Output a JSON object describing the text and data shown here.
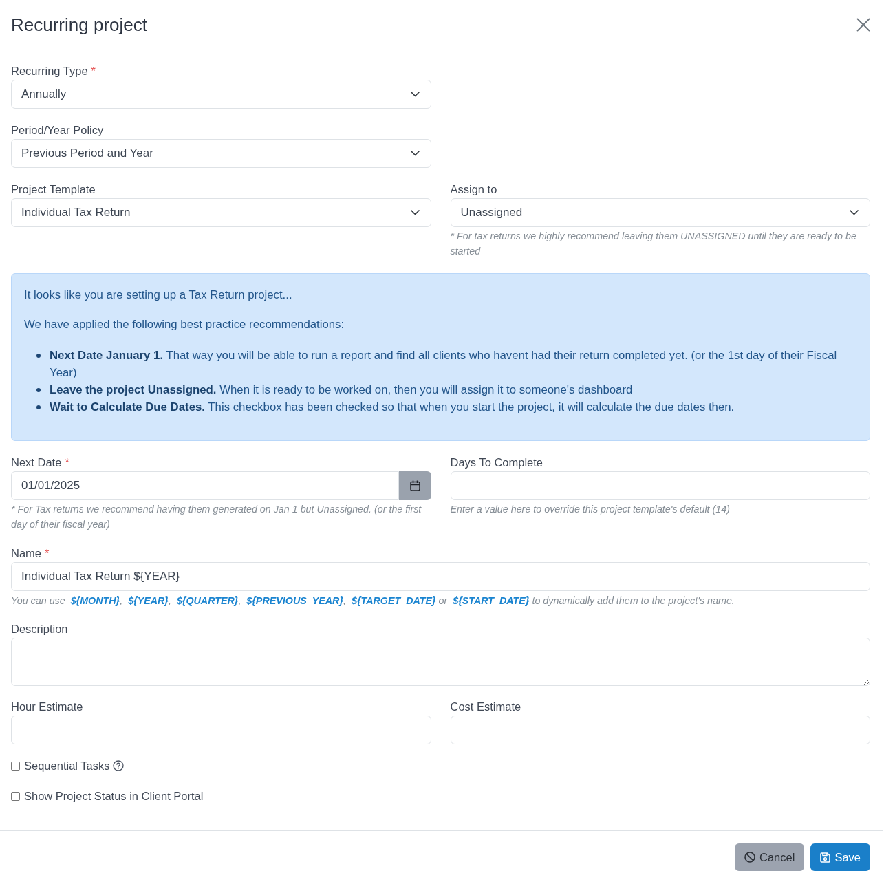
{
  "dialog": {
    "title": "Recurring project"
  },
  "recurring_type": {
    "label": "Recurring Type",
    "required_mark": "*",
    "value": "Annually"
  },
  "period_year_policy": {
    "label": "Period/Year Policy",
    "value": "Previous Period and Year"
  },
  "project_template": {
    "label": "Project Template",
    "value": "Individual Tax Return"
  },
  "assign_to": {
    "label": "Assign to",
    "value": "Unassigned",
    "hint": "* For tax returns we highly recommend leaving them UNASSIGNED until they are ready to be started"
  },
  "alert": {
    "paragraphs": [
      "It looks like you are setting up a Tax Return project...",
      "We have applied the following best practice recommendations:"
    ],
    "items": [
      "**Next Date January 1.** That way you will be able to run a report and find all clients who havent had their return completed yet. (or the 1st day of their Fiscal Year)",
      "**Leave the project Unassigned.** When it is ready to be worked on, then you will assign it to someone's dashboard",
      "**Wait to Calculate Due Dates.** This checkbox has been checked so that when you start the project, it will calculate the due dates then."
    ]
  },
  "next_date": {
    "label": "Next Date",
    "required_mark": "*",
    "value": "01/01/2025",
    "hint": "* For Tax returns we recommend having them generated on Jan 1 but Unassigned. (or the first day of their fiscal year)"
  },
  "days_to_complete": {
    "label": "Days To Complete",
    "hint": "Enter a value here to override this project template's default (14)"
  },
  "name": {
    "label": "Name",
    "required_mark": "*",
    "value": "Individual Tax Return ${YEAR}",
    "hint": "You can use **${MONTH}**, **${YEAR}**, **${QUARTER}**, **${PREVIOUS_YEAR}**, **${TARGET_DATE}** or **${START_DATE}** to dynamically add them to the project's name."
  },
  "description": {
    "label": "Description"
  },
  "hour_estimate": {
    "label": "Hour Estimate"
  },
  "cost_estimate": {
    "label": "Cost Estimate"
  },
  "options": [
    {
      "label": "Sequential Tasks",
      "checked": false,
      "help_icon": true
    },
    {
      "label": "Show Project Status in Client Portal",
      "checked": false,
      "help_icon": false
    }
  ],
  "buttons": [
    {
      "kind": "cancel",
      "label": "Cancel"
    },
    {
      "kind": "save",
      "label": "Save"
    }
  ]
}
